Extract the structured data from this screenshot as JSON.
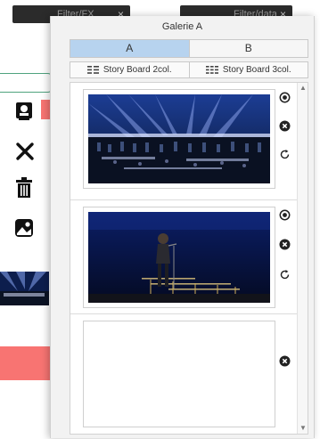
{
  "background": {
    "tabs": [
      {
        "label": "Filter/FX",
        "close": "×"
      },
      {
        "label": "Filter/data",
        "close": "×"
      }
    ]
  },
  "gallery": {
    "title": "Galerie A",
    "tabs": [
      "A",
      "B"
    ],
    "active_tab": "A",
    "storyboard": [
      {
        "label": "Story Board 2col.",
        "icon": "two-column-icon"
      },
      {
        "label": "Story Board 3col.",
        "icon": "three-column-icon"
      }
    ],
    "items": [
      {
        "image": "concert-stage-orchestra",
        "actions": [
          "show-icon",
          "delete-icon",
          "refresh-icon"
        ]
      },
      {
        "image": "singer-on-stage",
        "actions": [
          "show-icon",
          "delete-icon",
          "refresh-icon"
        ]
      },
      {
        "image": "empty-slot",
        "actions": [
          "delete-icon"
        ]
      }
    ],
    "scroll": {
      "up": "▲",
      "down": "▼"
    }
  },
  "colors": {
    "active_tab": "#b7d3ef",
    "red_button": "#f87472",
    "green_outline": "#4fa37e"
  }
}
